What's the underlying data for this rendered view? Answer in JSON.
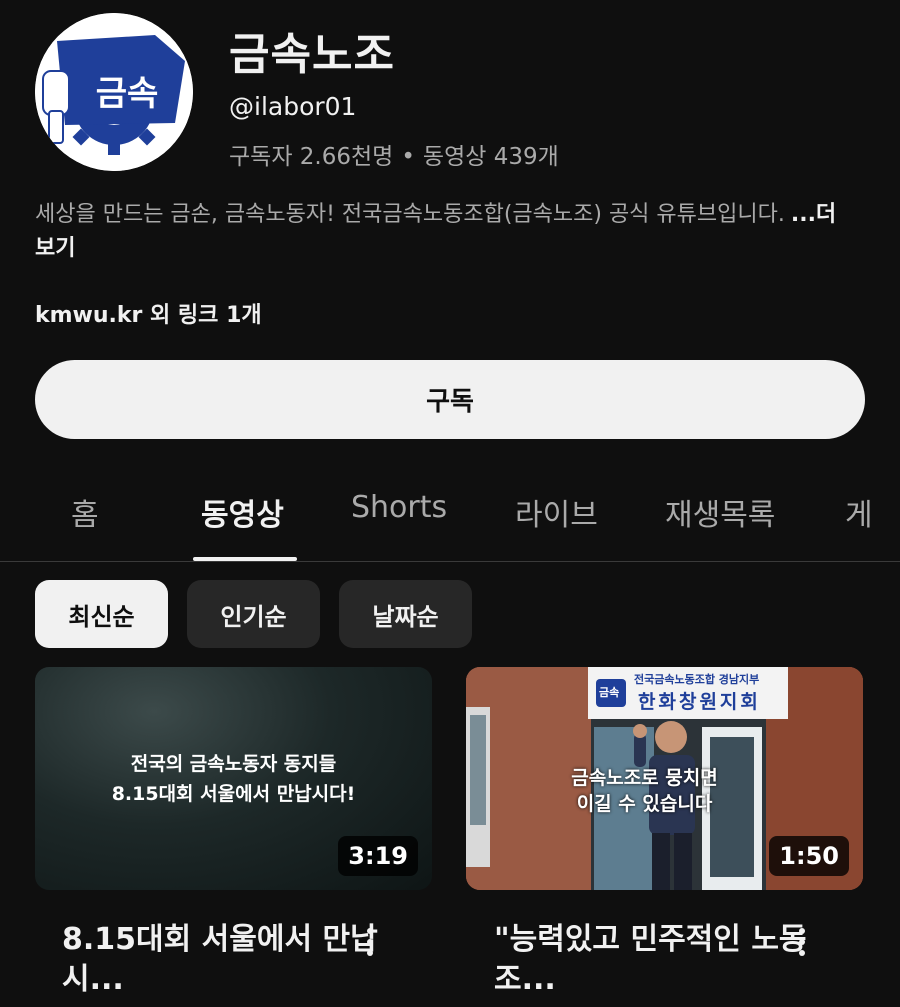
{
  "channel": {
    "name": "금속노조",
    "handle": "@ilabor01",
    "subscribers": "구독자 2.66천명",
    "separator": "•",
    "videos": "동영상 439개",
    "avatar_text": "금속",
    "description": "세상을 만드는 금손, 금속노동자! 전국금속노동조합(금속노조) 공식 유튜브입니다.",
    "more_label": "...더보기",
    "links": "kmwu.kr 외 링크 1개",
    "subscribe_label": "구독"
  },
  "tabs": [
    {
      "label": "홈",
      "active": false
    },
    {
      "label": "동영상",
      "active": true
    },
    {
      "label": "Shorts",
      "active": false
    },
    {
      "label": "라이브",
      "active": false
    },
    {
      "label": "재생목록",
      "active": false
    },
    {
      "label": "게",
      "active": false
    }
  ],
  "chips": [
    {
      "label": "최신순",
      "selected": true
    },
    {
      "label": "인기순",
      "selected": false
    },
    {
      "label": "날짜순",
      "selected": false
    }
  ],
  "videos": [
    {
      "thumb_lines": [
        "전국의 금속노동자 동지들",
        "8.15대회 서울에서 만납시다!"
      ],
      "duration": "3:19",
      "title": "8.15대회 서울에서 만납시..."
    },
    {
      "sign_text": "전국금속노동조합 경남지부",
      "sign_big": "한화창원지회",
      "sign_logo": "금속",
      "thumb_lines": [
        "금속노조로 뭉치면",
        "이길 수 있습니다"
      ],
      "duration": "1:50",
      "title": "\"능력있고 민주적인 노동조..."
    }
  ],
  "colors": {
    "background": "#0f0f0f",
    "primary_text": "#f1f1f1",
    "secondary_text": "#aaaaaa",
    "chip_bg": "#272727",
    "logo_blue": "#1f3f9a"
  }
}
